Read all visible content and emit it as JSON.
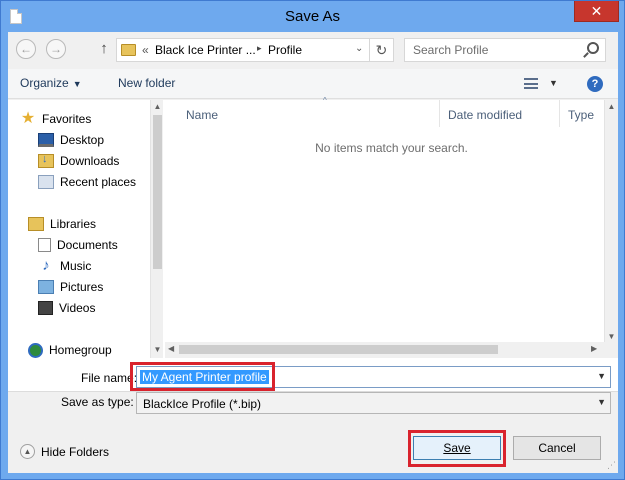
{
  "window": {
    "title": "Save As",
    "close_glyph": "✕"
  },
  "address": {
    "back_glyph": "←",
    "forward_glyph": "→",
    "up_glyph": "↑",
    "prefix": "«",
    "crumbs": [
      "Black Ice Printer ...",
      "Profile"
    ],
    "separator": "▸",
    "dropdown_glyph": "⌄",
    "refresh_glyph": "↻"
  },
  "search": {
    "placeholder": "Search Profile"
  },
  "toolbar": {
    "organize": "Organize",
    "caret": "▼",
    "new_folder": "New folder",
    "help": "?"
  },
  "nav": {
    "items": [
      {
        "label": "Favorites",
        "icon": "star-icon"
      },
      {
        "label": "Desktop",
        "icon": "desktop-icon"
      },
      {
        "label": "Downloads",
        "icon": "downloads-icon"
      },
      {
        "label": "Recent places",
        "icon": "recent-places-icon"
      },
      {
        "label": "Libraries",
        "icon": "libraries-icon"
      },
      {
        "label": "Documents",
        "icon": "documents-icon"
      },
      {
        "label": "Music",
        "icon": "music-icon"
      },
      {
        "label": "Pictures",
        "icon": "pictures-icon"
      },
      {
        "label": "Videos",
        "icon": "videos-icon"
      },
      {
        "label": "Homegroup",
        "icon": "homegroup-icon"
      }
    ]
  },
  "files": {
    "columns": [
      "Name",
      "Date modified",
      "Type"
    ],
    "sort_glyph": "^",
    "empty_message": "No items match your search."
  },
  "form": {
    "file_name_label": "File name:",
    "file_name_value": "My Agent Printer profile",
    "save_type_label": "Save as type:",
    "save_type_value": "BlackIce Profile (*.bip)",
    "dropdown_glyph": "▼"
  },
  "footer": {
    "hide_folders": "Hide Folders",
    "hide_glyph": "▲",
    "save": "Save",
    "cancel": "Cancel"
  },
  "colors": {
    "accent": "#6ea9ee",
    "close": "#c7362d",
    "highlight": "#d9232d",
    "selection": "#3399ff"
  }
}
